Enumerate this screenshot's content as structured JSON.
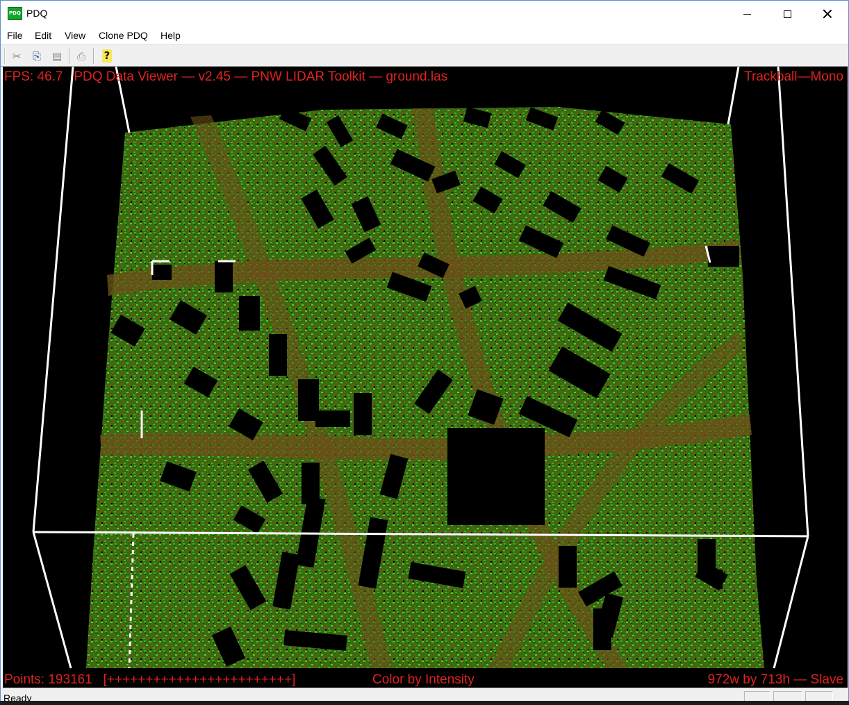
{
  "window": {
    "title": "PDQ",
    "icon_text": "PDQ",
    "controls": {
      "minimize": "minimize",
      "maximize": "maximize",
      "close": "close"
    }
  },
  "menu": {
    "items": [
      "File",
      "Edit",
      "View",
      "Clone PDQ",
      "Help"
    ]
  },
  "toolbar": {
    "buttons": [
      {
        "name": "cut",
        "icon": "scissors-icon",
        "glyph": "✂",
        "enabled": false
      },
      {
        "name": "copy",
        "icon": "copy-icon",
        "glyph": "⎘",
        "enabled": true
      },
      {
        "name": "paste",
        "icon": "paste-icon",
        "glyph": "▤",
        "enabled": false
      },
      {
        "name": "print",
        "icon": "printer-icon",
        "glyph": "⎙",
        "enabled": false
      },
      {
        "name": "help",
        "icon": "help-icon",
        "glyph": "?",
        "enabled": true
      }
    ]
  },
  "viewer": {
    "fps": "FPS: 46.7",
    "title": "PDQ Data Viewer — v2.45 — PNW LIDAR Toolkit — ground.las",
    "mode": "Trackball—Mono",
    "points": "Points: 193161",
    "progress": "[++++++++++++++++++++++++]",
    "color_mode": "Color by Intensity",
    "size_info": "972w by 713h — Slave",
    "overlay_color": "#e0231f",
    "background": "#000000",
    "point_colors": [
      "#2fb81f",
      "#4fd02a",
      "#6b5a16",
      "#8a4a1a",
      "#3e8f1c"
    ]
  },
  "status": {
    "text": "Ready"
  }
}
